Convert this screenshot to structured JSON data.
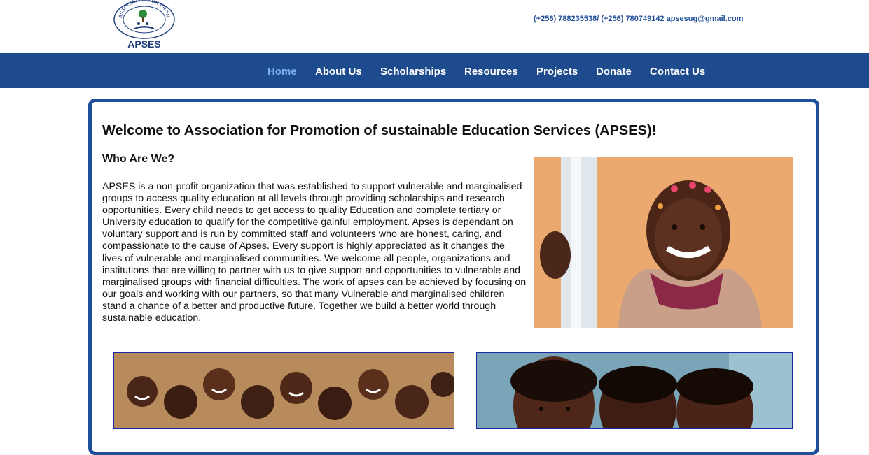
{
  "header": {
    "logo_text": "APSES",
    "logo_ring_text": "ASSOCIATION FOR PROMOTION OF SUSTAINABLE EDUCATION SERVICES",
    "contact": "(+256) 788235538/ (+256) 780749142 apsesug@gmail.com"
  },
  "nav": {
    "items": [
      {
        "label": "Home",
        "active": true
      },
      {
        "label": "About Us"
      },
      {
        "label": "Scholarships"
      },
      {
        "label": "Resources"
      },
      {
        "label": "Projects"
      },
      {
        "label": "Donate"
      },
      {
        "label": "Contact Us"
      }
    ]
  },
  "main": {
    "title": "Welcome to Association for Promotion of sustainable Education Services (APSES)!",
    "subtitle": "Who Are We?",
    "body": "APSES is a non-profit organization that was established to support vulnerable and marginalised groups to access quality education at all levels through providing scholarships and research opportunities. Every child needs to get access to quality Education and complete tertiary or University education to qualify for the competitive gainful employment. Apses is dependant on voluntary support and is run by committed staff and volunteers who are honest, caring, and compassionate to the cause of Apses. Every support is highly appreciated as it changes the lives of vulnerable and marginalised communities. We welcome all people, organizations and institutions that are willing to partner with us to give support and opportunities to vulnerable and marginalised groups with financial difficulties. The work of apses can be achieved by focusing on our goals and working with our partners, so that many Vulnerable and marginalised children stand a chance of a better and productive future. Together we build a better world through sustainable education."
  },
  "colors": {
    "nav_bg": "#1e4a8e",
    "nav_active": "#7fb1f0",
    "panel_border": "#1f4e9a",
    "contact_text": "#1f4e9a"
  }
}
